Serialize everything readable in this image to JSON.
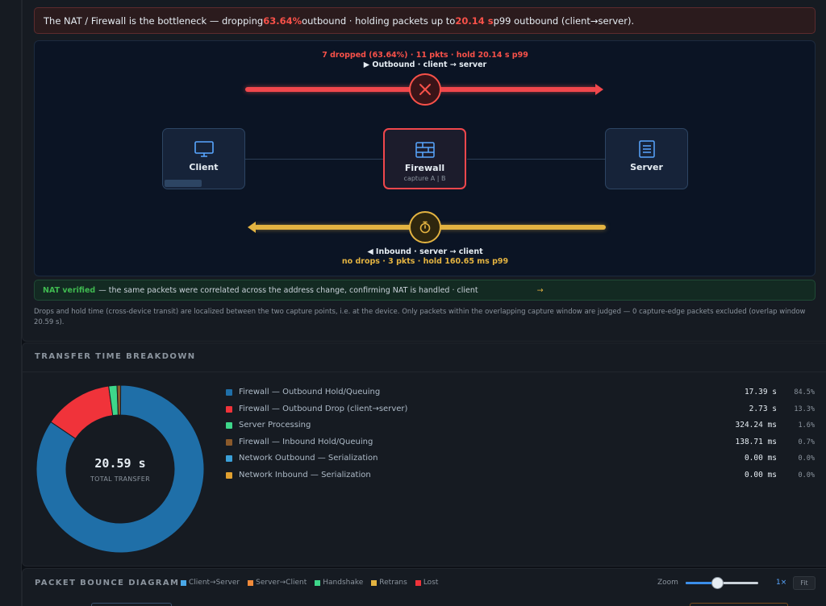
{
  "alert": {
    "prefix": "The NAT / Firewall is the bottleneck — dropping ",
    "drop_pct": "63.64%",
    "middle": " outbound · holding packets up to ",
    "hold_time": "20.14 s",
    "suffix": " p99 outbound (client→server)."
  },
  "topology": {
    "outbound_stats": "7 dropped (63.64%) · 11 pkts · hold 20.14 s p99",
    "outbound_label": "▶ Outbound · client → server",
    "inbound_label": "◀ Inbound · server → client",
    "inbound_stats": "no drops · 3 pkts · hold 160.65 ms p99",
    "nodes": [
      {
        "name": "Client",
        "sub": "",
        "icon": "monitor-icon"
      },
      {
        "name": "Firewall",
        "sub": "capture A | B",
        "icon": "firewall-icon"
      },
      {
        "name": "Server",
        "sub": "",
        "icon": "server-icon"
      }
    ]
  },
  "nat": {
    "verified": "NAT verified",
    "text": " — the same packets were correlated across the address change, confirming NAT is handled · client",
    "tail": "→"
  },
  "note": "Drops and hold time (cross-device transit) are localized between the two capture points, i.e. at the device. Only packets within the overlapping capture window are judged — 0 capture-edge packets excluded (overlap window 20.59 s).",
  "breakdown": {
    "title": "TRANSFER TIME BREAKDOWN",
    "total_value": "20.59 s",
    "total_label": "TOTAL TRANSFER",
    "items": [
      {
        "label": "Firewall — Outbound Hold/Queuing",
        "value": "17.39 s",
        "pct": "84.5%",
        "fraction": 0.845,
        "color": "#1f6fa8"
      },
      {
        "label": "Firewall — Outbound Drop (client→server)",
        "value": "2.73 s",
        "pct": "13.3%",
        "fraction": 0.133,
        "color": "#f0333a"
      },
      {
        "label": "Server Processing",
        "value": "324.24 ms",
        "pct": "1.6%",
        "fraction": 0.016,
        "color": "#3ed68a"
      },
      {
        "label": "Firewall — Inbound Hold/Queuing",
        "value": "138.71 ms",
        "pct": "0.7%",
        "fraction": 0.007,
        "color": "#8b5a2b"
      },
      {
        "label": "Network Outbound — Serialization",
        "value": "0.00 ms",
        "pct": "0.0%",
        "fraction": 0.0,
        "color": "#3ba0d8"
      },
      {
        "label": "Network Inbound — Serialization",
        "value": "0.00 ms",
        "pct": "0.0%",
        "fraction": 0.0,
        "color": "#e0a030"
      }
    ]
  },
  "bounce": {
    "title": "PACKET BOUNCE DIAGRAM",
    "legend": [
      {
        "label": "Client→Server",
        "color": "#4aa8e8"
      },
      {
        "label": "Server→Client",
        "color": "#f08a3a"
      },
      {
        "label": "Handshake",
        "color": "#3ed68a"
      },
      {
        "label": "Retrans",
        "color": "#e3b341"
      },
      {
        "label": "Lost",
        "color": "#f0333a"
      }
    ],
    "zoom_label": "Zoom",
    "zoom_value": "1×",
    "fit_label": "Fit"
  }
}
